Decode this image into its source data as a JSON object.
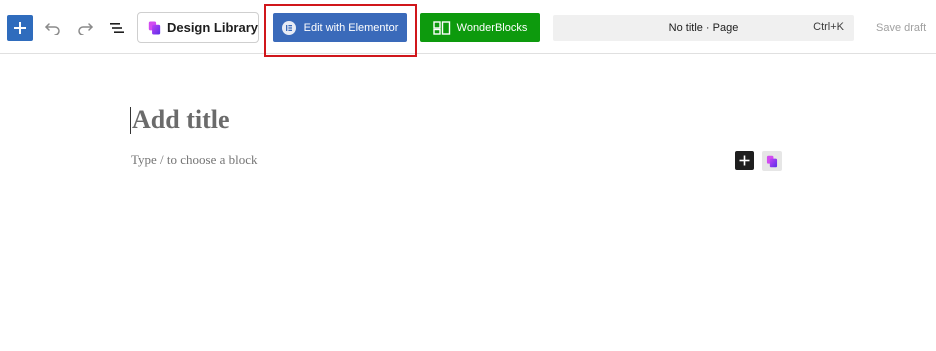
{
  "toolbar": {
    "add_block_tooltip": "Add block",
    "undo_tooltip": "Undo",
    "redo_tooltip": "Redo",
    "outline_tooltip": "Document Overview",
    "design_library_label": "Design Library",
    "elementor_label": "Edit with Elementor",
    "wonderblocks_label": "WonderBlocks",
    "command_title": "No title · Page",
    "command_shortcut": "Ctrl+K",
    "save_draft_label": "Save draft"
  },
  "editor": {
    "title_placeholder": "Add title",
    "paragraph_placeholder": "Type / to choose a block"
  },
  "colors": {
    "add_block_bg": "#2f6cbd",
    "elementor_bg": "#3a6aba",
    "wonderblocks_bg": "#0d9a0d",
    "highlight_border": "#d0161b",
    "command_bar_bg": "#f0f0f0"
  },
  "icons": {
    "add_block": "plus-icon",
    "undo": "undo-icon",
    "redo": "redo-icon",
    "outline": "list-view-icon",
    "design_library": "design-library-logo-icon",
    "elementor": "elementor-logo-icon",
    "wonderblocks": "wonderblocks-icon",
    "inline_inserter": "plus-icon",
    "inline_library": "design-library-logo-icon"
  }
}
